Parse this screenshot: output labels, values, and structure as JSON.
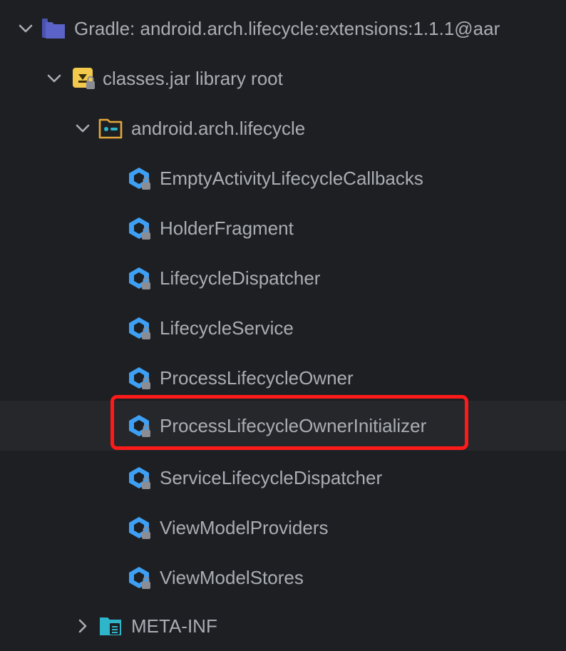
{
  "tree": {
    "root": {
      "label": "Gradle: android.arch.lifecycle:extensions:1.1.1@aar",
      "expanded": true,
      "icon": "library-folder-icon"
    },
    "jar": {
      "label": "classes.jar library root",
      "expanded": true,
      "icon": "jar-archive-icon"
    },
    "package": {
      "label": "android.arch.lifecycle",
      "expanded": true,
      "icon": "package-folder-icon"
    },
    "classes": [
      {
        "label": "EmptyActivityLifecycleCallbacks"
      },
      {
        "label": "HolderFragment"
      },
      {
        "label": "LifecycleDispatcher"
      },
      {
        "label": "LifecycleService"
      },
      {
        "label": "ProcessLifecycleOwner"
      },
      {
        "label": "ProcessLifecycleOwnerInitializer",
        "selected": true
      },
      {
        "label": "ServiceLifecycleDispatcher"
      },
      {
        "label": "ViewModelProviders"
      },
      {
        "label": "ViewModelStores"
      }
    ],
    "meta": {
      "label": "META-INF",
      "expanded": false,
      "icon": "resources-folder-icon"
    }
  },
  "colors": {
    "background": "#1e1f22",
    "selected_row": "#26272b",
    "text": "#a9adb4",
    "highlight_border": "#ff1a1a",
    "class_icon": "#3da0f5",
    "jar_icon": "#f2c94c",
    "folder_blue": "#5b63c8",
    "folder_teal": "#2fb5c9"
  }
}
